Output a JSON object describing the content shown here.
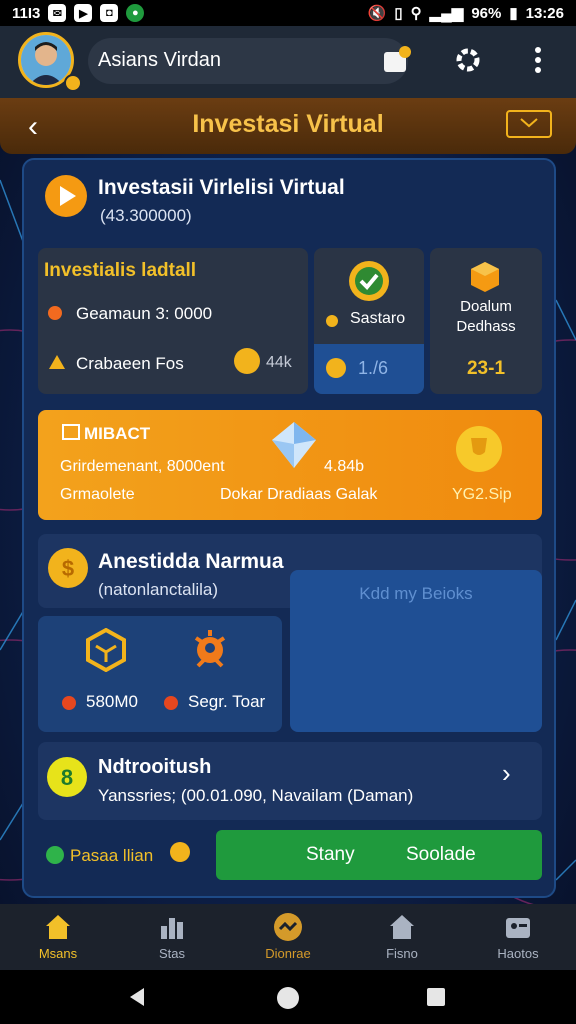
{
  "status_bar": {
    "left_text": "11I3",
    "battery": "96%",
    "time": "13:26"
  },
  "header": {
    "user_name": "Asians Virdan"
  },
  "title_bar": {
    "title": "Investasi Virtual"
  },
  "hero": {
    "title": "Investasii Virlelisi Virtual",
    "subtitle": "(43.300000)"
  },
  "detail_card": {
    "title": "Investialis ladtall",
    "row1": "Geamaun 3: 0000",
    "row2": "Crabaeen Fos",
    "row2_value": "44k"
  },
  "status_card": {
    "label": "Sastaro",
    "value": "1./6"
  },
  "deposit_card": {
    "label_line1": "Doalum",
    "label_line2": "Dedhass",
    "value": "23-1"
  },
  "orange_banner": {
    "title": "MIBACT",
    "line1": "Grirdemenant, 8000ent",
    "value": "4.84b",
    "line2_left": "Grmaolete",
    "line2_mid": "Dokar Dradiaas Galak",
    "right_value": "YG2.Sip"
  },
  "section2": {
    "title": "Anestidda Narmua",
    "subtitle": "(natonlanctalila)",
    "side_text": "Kdd my Beioks",
    "stat1": "580M0",
    "stat2": "Segr. Toar"
  },
  "notif": {
    "title": "Ndtrooitush",
    "text": "Yanssries; (00.01.090, Navailam (Daman)"
  },
  "footer_actions": {
    "left_label": "Pasaa llian",
    "button_left": "Stany",
    "button_right": "Soolade"
  },
  "bottom_nav": [
    {
      "label": "Msans",
      "icon": "home-icon",
      "active": true
    },
    {
      "label": "Stas",
      "icon": "chart-icon",
      "active": false
    },
    {
      "label": "Dionrae",
      "icon": "invest-icon",
      "active": false
    },
    {
      "label": "Fisno",
      "icon": "house-icon",
      "active": false
    },
    {
      "label": "Haotos",
      "icon": "id-card-icon",
      "active": false
    }
  ],
  "colors": {
    "accent_gold": "#f2b31c",
    "panel_blue": "#132a55",
    "orange": "#f59a12",
    "green_button": "#1f9a3d"
  }
}
